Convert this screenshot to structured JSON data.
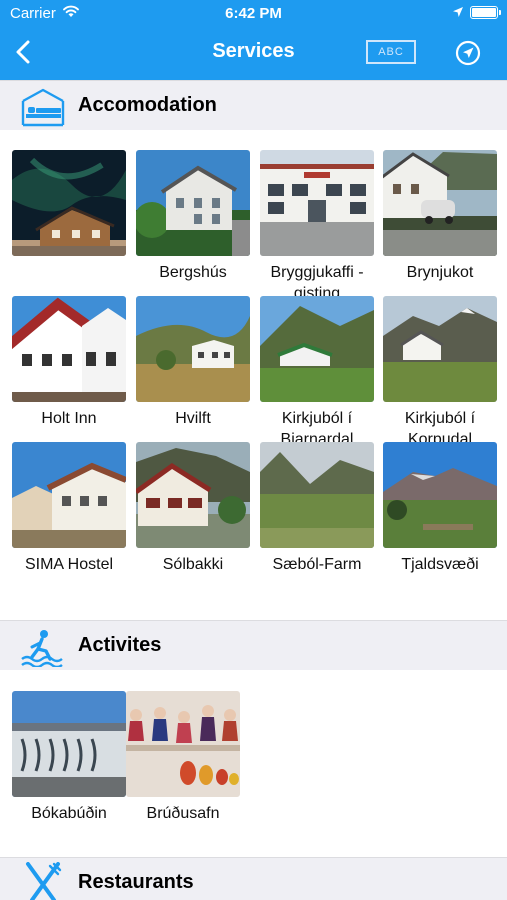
{
  "status_bar": {
    "carrier": "Carrier",
    "time": "6:42 PM"
  },
  "nav": {
    "title": "Services",
    "abc_label": "ABC",
    "back_icon": "chevron-left-icon",
    "locate_icon": "location-arrow-icon"
  },
  "colors": {
    "nav_bg": "#1e9bf0",
    "section_bg": "#efeff4",
    "icon_blue": "#1e9bf0"
  },
  "sections": [
    {
      "title": "Accomodation",
      "icon": "bed-icon",
      "items": [
        {
          "label": ""
        },
        {
          "label": "Bergshús"
        },
        {
          "label": "Bryggjukaffi - gisting"
        },
        {
          "label": "Brynjukot"
        },
        {
          "label": "Holt Inn"
        },
        {
          "label": "Hvilft"
        },
        {
          "label": "Kirkjuból í Bjarnardal"
        },
        {
          "label": "Kirkjuból í Korpudal"
        },
        {
          "label": "SIMA Hostel"
        },
        {
          "label": "Sólbakki"
        },
        {
          "label": "Sæból-Farm"
        },
        {
          "label": "Tjaldsvæði"
        }
      ]
    },
    {
      "title": "Activites",
      "icon": "swimmer-icon",
      "items": [
        {
          "label": "Bókabúðin"
        },
        {
          "label": "Brúðusafn"
        }
      ]
    },
    {
      "title": "Restaurants",
      "icon": "fork-knife-icon",
      "items": []
    }
  ]
}
